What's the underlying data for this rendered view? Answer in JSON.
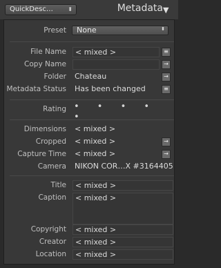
{
  "header": {
    "preset_dropdown": "QuickDesc…",
    "title": "Metadata",
    "collapse_glyph": "▼",
    "dropdown_arrows": "⬍"
  },
  "preset": {
    "label": "Preset",
    "value": "None",
    "arrows": "⬍"
  },
  "file_name": {
    "label": "File Name",
    "value": "< mixed >"
  },
  "copy_name": {
    "label": "Copy Name",
    "value": ""
  },
  "folder": {
    "label": "Folder",
    "value": "Chateau"
  },
  "metadata_status": {
    "label": "Metadata Status",
    "value": "Has been changed"
  },
  "rating": {
    "label": "Rating",
    "value": "• • • • •"
  },
  "dimensions": {
    "label": "Dimensions",
    "value": "< mixed >"
  },
  "cropped": {
    "label": "Cropped",
    "value": "< mixed >"
  },
  "capture_time": {
    "label": "Capture Time",
    "value": "< mixed >"
  },
  "camera": {
    "label": "Camera",
    "value": "NIKON COR…X #3164405"
  },
  "title_field": {
    "label": "Title",
    "value": "< mixed >"
  },
  "caption": {
    "label": "Caption",
    "value": "< mixed >"
  },
  "copyright": {
    "label": "Copyright",
    "value": "< mixed >"
  },
  "creator": {
    "label": "Creator",
    "value": "< mixed >"
  },
  "location": {
    "label": "Location",
    "value": "< mixed >"
  },
  "icons": {
    "list": "list-icon",
    "arrow": "arrow-right-icon"
  },
  "colors": {
    "panel": "#383838",
    "background": "#2a2a2a",
    "text": "#dcdcdc"
  }
}
